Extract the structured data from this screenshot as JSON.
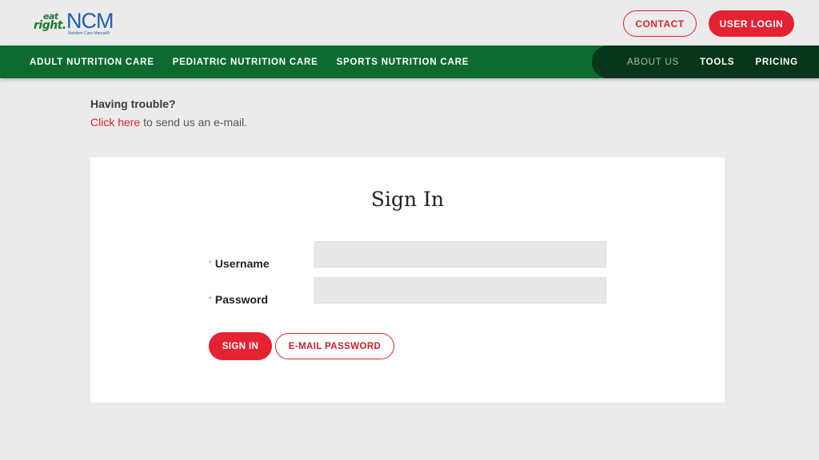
{
  "header": {
    "logo": {
      "eat": "eat",
      "right": "right.",
      "ncm": "NCM",
      "tagline": "Nutrition Care Manual®"
    },
    "contact_label": "CONTACT",
    "login_label": "USER LOGIN"
  },
  "nav": {
    "left_items": [
      {
        "label": "ADULT NUTRITION CARE"
      },
      {
        "label": "PEDIATRIC NUTRITION CARE"
      },
      {
        "label": "SPORTS NUTRITION CARE"
      }
    ],
    "right_items": [
      {
        "label": "ABOUT US"
      },
      {
        "label": "TOOLS"
      },
      {
        "label": "PRICING"
      }
    ]
  },
  "help": {
    "title": "Having trouble?",
    "link_text": "Click here",
    "rest_text": " to send us an e-mail."
  },
  "signin": {
    "title": "Sign In",
    "required_marker": "*",
    "username_label": "Username",
    "password_label": "Password",
    "username_value": "",
    "password_value": "",
    "signin_button": "SIGN IN",
    "email_password_button": "E-MAIL PASSWORD"
  },
  "colors": {
    "brand_green": "#0d6b30",
    "nav_dark": "#07361a",
    "accent_red": "#e42231",
    "logo_blue": "#1f5fae"
  }
}
